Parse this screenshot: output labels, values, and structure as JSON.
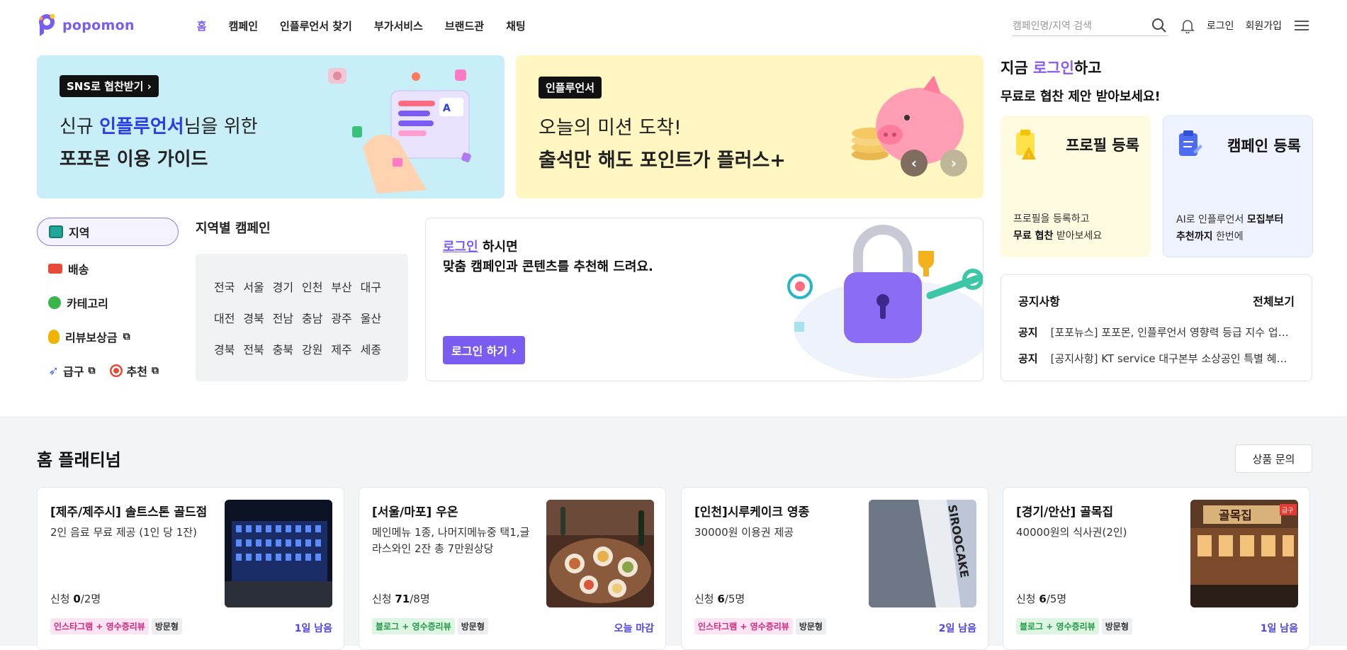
{
  "header": {
    "logo_text": "popomon",
    "nav": [
      "홈",
      "캠페인",
      "인플루언서 찾기",
      "부가서비스",
      "브랜드관",
      "채팅"
    ],
    "search_placeholder": "캠페인명/지역 검색",
    "login": "로그인",
    "signup": "회원가입"
  },
  "banners": [
    {
      "tag": "SNS로 협찬받기 ›",
      "line1_pre": "신규 ",
      "line1_hl": "인플루언서",
      "line1_post": "님을 위한",
      "line2": "포포몬 이용 가이드"
    },
    {
      "tag": "인플루언서",
      "line1": "오늘의 미션 도착!",
      "line2": "출석만 해도 포인트가 플러스+"
    }
  ],
  "login_prompt": {
    "line1_pre": "지금 ",
    "line1_hl": "로그인",
    "line1_post": "하고",
    "line2": "무료로 협찬 제안 받아보세요!",
    "cards": [
      {
        "title": "프로필 등록",
        "desc1": "프로필을 등록하고",
        "desc2_bold": "무료 협찬",
        "desc2_rest": " 받아보세요"
      },
      {
        "title": "캠페인 등록",
        "desc1_pre": "AI로 인플루언서 ",
        "desc1_bold": "모집부터",
        "desc2_bold": "추천까지",
        "desc2_rest": " 한번에"
      }
    ]
  },
  "sidebar": {
    "items": [
      "지역",
      "배송",
      "카테고리",
      "리뷰보상금",
      "급구",
      "추천"
    ]
  },
  "region": {
    "title": "지역별 캠페인",
    "rows": [
      [
        "전국",
        "서울",
        "경기",
        "인천",
        "부산",
        "대구"
      ],
      [
        "대전",
        "경북",
        "전남",
        "충남",
        "광주",
        "울산"
      ],
      [
        "경북",
        "전북",
        "충북",
        "강원",
        "제주",
        "세종"
      ]
    ]
  },
  "promo": {
    "link": "로그인",
    "line1_rest": " 하시면",
    "line2": "맞춤 캠페인과 콘텐츠를 추천해 드려요.",
    "button": "로그인 하기"
  },
  "notice": {
    "title": "공지사항",
    "more": "전체보기",
    "items": [
      {
        "label": "공지",
        "text": "[포포뉴스] 포포몬, 인플루언서 영향력 등급 지수 업데..."
      },
      {
        "label": "공지",
        "text": "[공지사항] KT service 대구본부 소상공인 특별 혜택 ..."
      }
    ]
  },
  "platinum": {
    "title": "홈 플래티넘",
    "inquiry": "상품 문의",
    "cards": [
      {
        "title": "[제주/제주시] 솔트스톤 골드점",
        "desc": "2인 음료 무료 제공 (1인 당 1잔)",
        "apply_pre": "신청 ",
        "applied": "0",
        "total": "/2명",
        "tags": [
          {
            "text": "인스타그램 + 영수증리뷰",
            "kind": "insta"
          },
          {
            "text": "방문형",
            "kind": "visit"
          }
        ],
        "remaining": "1일 남음"
      },
      {
        "title": "[서울/마포] 우온",
        "desc": "메인메뉴 1종, 나머지메뉴중 택1,글라스와인 2잔 총 7만원상당",
        "apply_pre": "신청 ",
        "applied": "71",
        "total": "/8명",
        "tags": [
          {
            "text": "블로그 + 영수증리뷰",
            "kind": "blog"
          },
          {
            "text": "방문형",
            "kind": "visit"
          }
        ],
        "remaining": "오늘 마감"
      },
      {
        "title": "[인천]시루케이크 영종",
        "desc": "30000원 이용권 제공",
        "apply_pre": "신청 ",
        "applied": "6",
        "total": "/5명",
        "tags": [
          {
            "text": "인스타그램 + 영수증리뷰",
            "kind": "insta"
          },
          {
            "text": "방문형",
            "kind": "visit"
          }
        ],
        "remaining": "2일 남음"
      },
      {
        "title": "[경기/안산] 골목집",
        "desc": "40000원의 식사권(2인)",
        "apply_pre": "신청 ",
        "applied": "6",
        "total": "/5명",
        "tags": [
          {
            "text": "블로그 + 영수증리뷰",
            "kind": "blog"
          },
          {
            "text": "방문형",
            "kind": "visit"
          }
        ],
        "remaining": "1일 남음"
      }
    ],
    "image_labels": [
      "SIROOCAKE",
      "골목집",
      "급구"
    ]
  },
  "colors": {
    "brand": "#7b5cf0",
    "highlight_blue": "#2a3ce6",
    "banner1_bg": "#c8eef7",
    "banner2_bg": "#fff6c2",
    "remaining": "#4f46e5"
  }
}
